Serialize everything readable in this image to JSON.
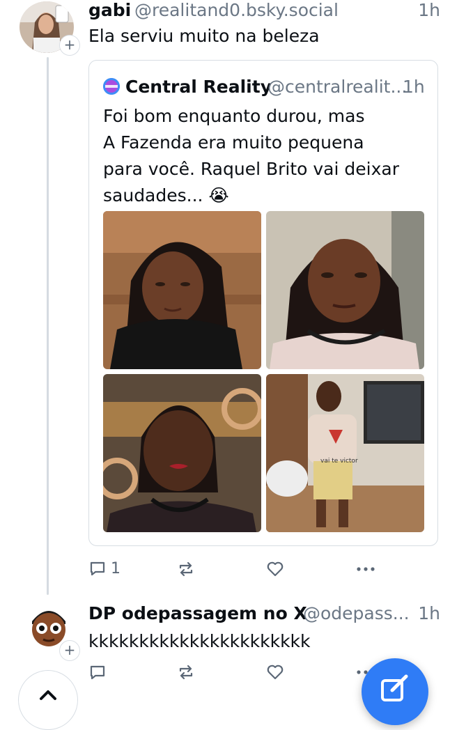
{
  "post1": {
    "author_name": "gabi",
    "author_handle": "@realitand0.bsky.social",
    "time": "1h",
    "text": "Ela serviu muito na beleza"
  },
  "quote": {
    "author_name": "Central Reality",
    "author_handle": "@centralrealit...",
    "time": "1h",
    "text_lines": [
      "Foi bom enquanto durou, mas",
      "A Fazenda era muito pequena",
      "para você. Raquel Brito vai deixar",
      "saudades..."
    ],
    "emoji": "😭",
    "avatar_text": "Central Reality",
    "photo_caption": "vai te victor"
  },
  "post1_actions": {
    "reply_count": "1",
    "repost_count": "",
    "like_count": ""
  },
  "post2": {
    "author_name": "DP odepassagem no X",
    "author_handle": "@odepass...",
    "time": "1h",
    "text": "kkkkkkkkkkkkkkkkkkkkkk"
  },
  "colors": {
    "accent": "#2f7cf6",
    "muted": "#6b7785",
    "border": "#d7dde3"
  },
  "icons": [
    "plus-icon",
    "reply-icon",
    "repost-icon",
    "like-icon",
    "more-icon",
    "compose-icon",
    "chevron-up-icon"
  ]
}
